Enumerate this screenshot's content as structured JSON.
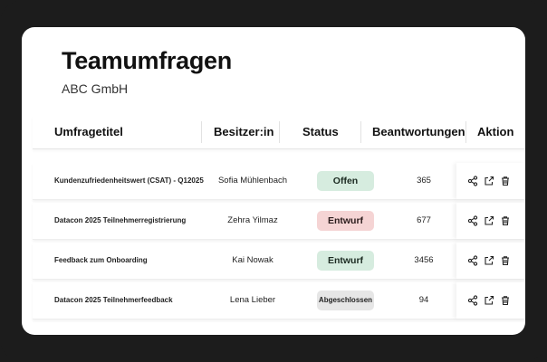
{
  "page": {
    "title": "Teamumfragen",
    "subtitle": "ABC GmbH"
  },
  "table": {
    "headers": {
      "title": "Umfragetitel",
      "owner": "Besitzer:in",
      "status": "Status",
      "responses": "Beantwortungen",
      "action": "Aktion"
    },
    "rows": [
      {
        "title": "Kundenzufriedenheitswert (CSAT) - Q12025",
        "owner": "Sofia Mühlenbach",
        "status": "Offen",
        "status_color": "green",
        "responses": "365"
      },
      {
        "title": "Datacon 2025 Teilnehmerregistrierung",
        "owner": "Zehra Yilmaz",
        "status": "Entwurf",
        "status_color": "red",
        "responses": "677"
      },
      {
        "title": "Feedback zum Onboarding",
        "owner": "Kai Nowak",
        "status": "Entwurf",
        "status_color": "green",
        "responses": "3456"
      },
      {
        "title": "Datacon 2025 Teilnehmerfeedback",
        "owner": "Lena Lieber",
        "status": "Abgeschlossen",
        "status_color": "grey",
        "responses": "94"
      }
    ],
    "row_actions": [
      "share-icon",
      "export-icon",
      "trash-icon"
    ]
  },
  "colors": {
    "frame": "#1c1c1c",
    "pill_green": "#d6ecdf",
    "pill_red": "#f5d4d4",
    "pill_grey": "#e6e6e6"
  }
}
